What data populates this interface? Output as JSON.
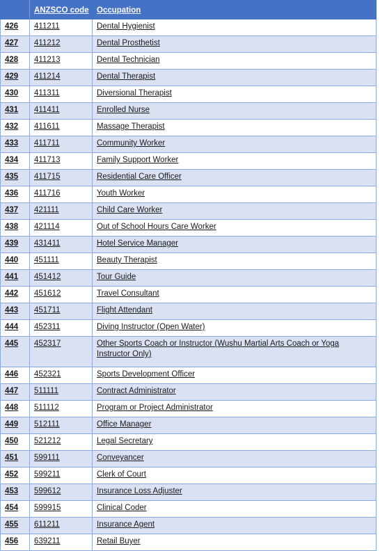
{
  "table": {
    "columns": {
      "index_header": "",
      "code_header": "ANZSCO code",
      "occupation_header": "Occupation"
    },
    "colors": {
      "header_background": "#4472C4",
      "header_text": "#FFFFFF",
      "row_stripe": "#D9E1F2",
      "row_plain": "#FFFFFF",
      "border": "#8EA9DB",
      "text": "#1A1A1A"
    },
    "rows": [
      {
        "index": "426",
        "code": "411211",
        "occupation": "Dental Hygienist"
      },
      {
        "index": "427",
        "code": "411212",
        "occupation": "Dental Prosthetist"
      },
      {
        "index": "428",
        "code": "411213",
        "occupation": "Dental Technician"
      },
      {
        "index": "429",
        "code": "411214",
        "occupation": "Dental Therapist"
      },
      {
        "index": "430",
        "code": "411311",
        "occupation": "Diversional Therapist"
      },
      {
        "index": "431",
        "code": "411411",
        "occupation": "Enrolled Nurse"
      },
      {
        "index": "432",
        "code": "411611",
        "occupation": "Massage Therapist"
      },
      {
        "index": "433",
        "code": "411711",
        "occupation": "Community Worker"
      },
      {
        "index": "434",
        "code": "411713",
        "occupation": "Family Support Worker"
      },
      {
        "index": "435",
        "code": "411715",
        "occupation": "Residential Care Officer"
      },
      {
        "index": "436",
        "code": "411716",
        "occupation": "Youth Worker"
      },
      {
        "index": "437",
        "code": "421111",
        "occupation": "Child Care Worker"
      },
      {
        "index": "438",
        "code": "421114",
        "occupation": "Out of School Hours Care Worker"
      },
      {
        "index": "439",
        "code": "431411",
        "occupation": "Hotel Service Manager"
      },
      {
        "index": "440",
        "code": "451111",
        "occupation": "Beauty Therapist"
      },
      {
        "index": "441",
        "code": "451412",
        "occupation": "Tour Guide"
      },
      {
        "index": "442",
        "code": "451612",
        "occupation": "Travel Consultant"
      },
      {
        "index": "443",
        "code": "451711",
        "occupation": "Flight Attendant"
      },
      {
        "index": "444",
        "code": "452311",
        "occupation": "Diving Instructor (Open Water)"
      },
      {
        "index": "445",
        "code": "452317",
        "occupation": "Other Sports Coach or Instructor (Wushu Martial Arts Coach or Yoga Instructor Only)"
      },
      {
        "index": "446",
        "code": "452321",
        "occupation": "Sports Development Officer"
      },
      {
        "index": "447",
        "code": "511111",
        "occupation": "Contract Administrator"
      },
      {
        "index": "448",
        "code": "511112",
        "occupation": "Program or Project Administrator"
      },
      {
        "index": "449",
        "code": "512111",
        "occupation": "Office Manager"
      },
      {
        "index": "450",
        "code": "521212",
        "occupation": "Legal Secretary"
      },
      {
        "index": "451",
        "code": "599111",
        "occupation": "Conveyancer"
      },
      {
        "index": "452",
        "code": "599211",
        "occupation": "Clerk of Court"
      },
      {
        "index": "453",
        "code": "599612",
        "occupation": "Insurance Loss Adjuster"
      },
      {
        "index": "454",
        "code": "599915",
        "occupation": "Clinical Coder"
      },
      {
        "index": "455",
        "code": "611211",
        "occupation": "Insurance Agent"
      },
      {
        "index": "456",
        "code": "639211",
        "occupation": "Retail Buyer"
      }
    ]
  }
}
